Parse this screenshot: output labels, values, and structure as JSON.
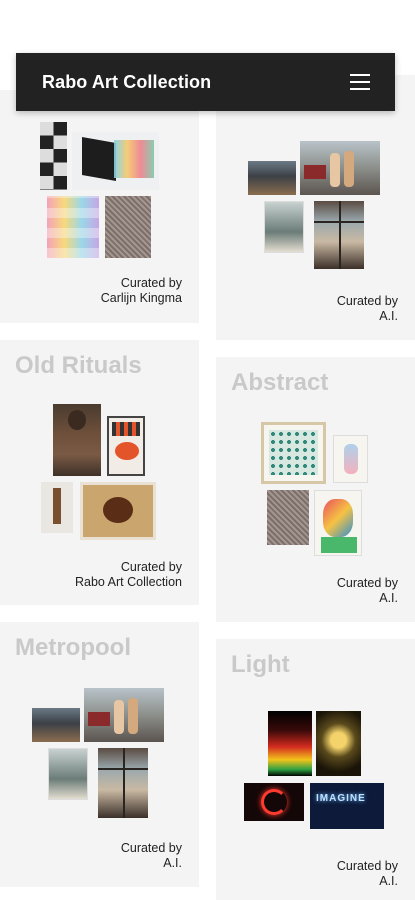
{
  "header": {
    "title": "Rabo Art Collection",
    "menu_icon": "hamburger-menu-icon"
  },
  "collections": [
    {
      "title": "",
      "curator_line1": "Curated by",
      "curator_line2": "Carlijn Kingma"
    },
    {
      "title": "",
      "curator_line1": "Curated by",
      "curator_line2": "A.I."
    },
    {
      "title": "Old Rituals",
      "curator_line1": "Curated by",
      "curator_line2": "Rabo Art Collection"
    },
    {
      "title": "Abstract",
      "curator_line1": "Curated by",
      "curator_line2": "A.I."
    },
    {
      "title": "Metropool",
      "curator_line1": "Curated by",
      "curator_line2": "A.I."
    },
    {
      "title": "Light",
      "curator_line1": "Curated by",
      "curator_line2": "A.I."
    }
  ],
  "colors": {
    "header_bg": "#222222",
    "card_bg": "#f4f4f4",
    "title_muted": "#c9c9c9"
  }
}
